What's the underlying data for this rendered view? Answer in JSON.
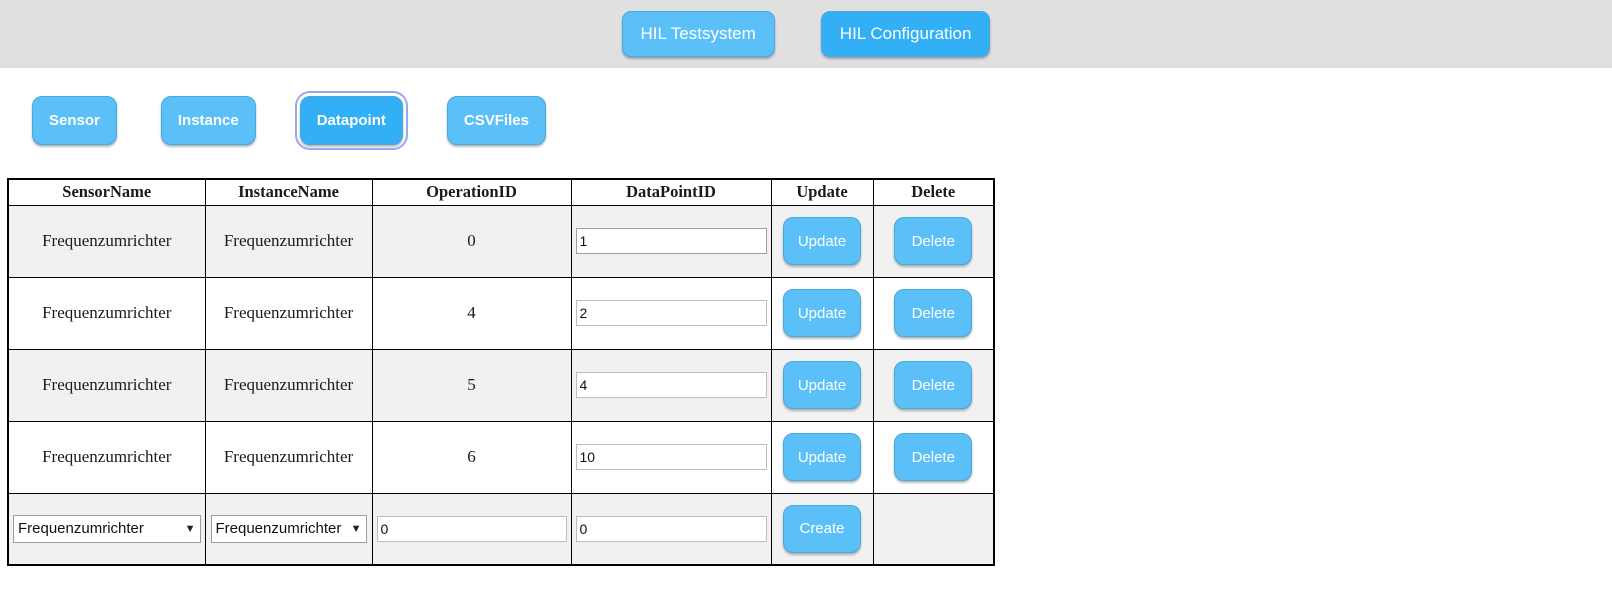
{
  "app_bar": {
    "buttons": [
      {
        "label": "HIL Testsystem",
        "active": false
      },
      {
        "label": "HIL Configuration",
        "active": true
      }
    ]
  },
  "tabs": [
    {
      "label": "Sensor",
      "active": false
    },
    {
      "label": "Instance",
      "active": false
    },
    {
      "label": "Datapoint",
      "active": true
    },
    {
      "label": "CSVFiles",
      "active": false
    }
  ],
  "table": {
    "columns": [
      "SensorName",
      "InstanceName",
      "OperationID",
      "DataPointID",
      "Update",
      "Delete"
    ],
    "rows": [
      {
        "sensor_name": "Frequenzumrichter",
        "instance_name": "Frequenzumrichter",
        "operation_id": "0",
        "data_point_id": "1",
        "update_label": "Update",
        "delete_label": "Delete"
      },
      {
        "sensor_name": "Frequenzumrichter",
        "instance_name": "Frequenzumrichter",
        "operation_id": "4",
        "data_point_id": "2",
        "update_label": "Update",
        "delete_label": "Delete"
      },
      {
        "sensor_name": "Frequenzumrichter",
        "instance_name": "Frequenzumrichter",
        "operation_id": "5",
        "data_point_id": "4",
        "update_label": "Update",
        "delete_label": "Delete"
      },
      {
        "sensor_name": "Frequenzumrichter",
        "instance_name": "Frequenzumrichter",
        "operation_id": "6",
        "data_point_id": "10",
        "update_label": "Update",
        "delete_label": "Delete"
      }
    ],
    "create_row": {
      "sensor_name_selected": "Frequenzumrichter",
      "instance_name_selected": "Frequenzumrichter",
      "operation_id_value": "0",
      "data_point_id_value": "0",
      "create_label": "Create",
      "dropdown_arrow": "▼"
    }
  },
  "colors": {
    "accent": "#5bc0f8",
    "accent_active": "#33aff5",
    "app_bar_bg": "#e0e0e0",
    "row_stripe": "#f1f1f1"
  }
}
